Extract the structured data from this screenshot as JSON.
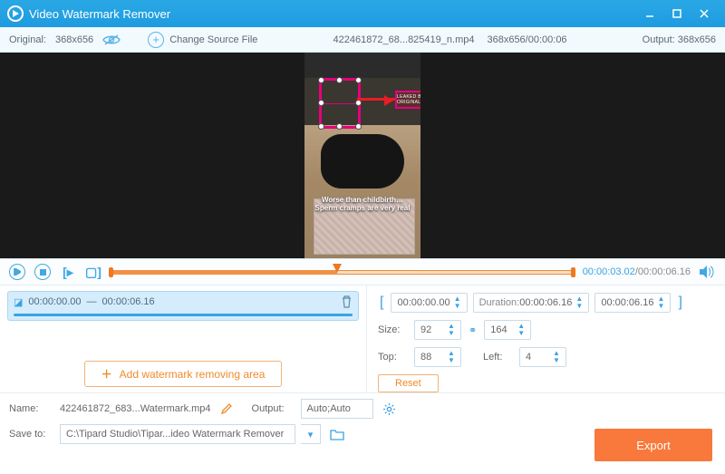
{
  "title": "Video Watermark Remover",
  "toolbar": {
    "original_label": "Original:",
    "original_value": "368x656",
    "change_source": "Change Source File",
    "filename": "422461872_68...825419_n.mp4",
    "dims_time": "368x656/00:00:06",
    "output_label": "Output:",
    "output_value": "368x656"
  },
  "video": {
    "caption": "Worse than childbirth… Sperm cramps are very real",
    "annot": "LEAKED BY ORIGINAL"
  },
  "transport": {
    "current": "00:00:03.02",
    "total": "00:00:06.16"
  },
  "segment": {
    "start": "00:00:00.00",
    "sep": "—",
    "end": "00:00:06.16"
  },
  "add_area": "Add watermark removing area",
  "params": {
    "start": "00:00:00.00",
    "duration_label": "Duration:",
    "duration": "00:00:06.16",
    "end": "00:00:06.16",
    "size_label": "Size:",
    "size_w": "92",
    "size_h": "164",
    "top_label": "Top:",
    "top": "88",
    "left_label": "Left:",
    "left": "4",
    "reset": "Reset"
  },
  "bottom": {
    "name_label": "Name:",
    "name": "422461872_683...Watermark.mp4",
    "output_label": "Output:",
    "output": "Auto;Auto",
    "save_label": "Save to:",
    "save_path": "C:\\Tipard Studio\\Tipar...ideo Watermark Remover"
  },
  "export": "Export"
}
